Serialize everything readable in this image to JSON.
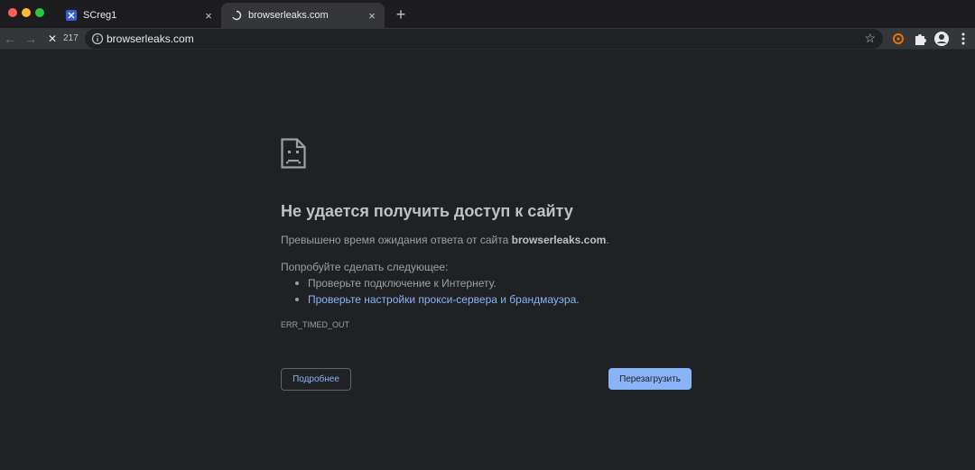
{
  "window": {
    "traffic_colors": [
      "#ff5f57",
      "#febc2e",
      "#28c840"
    ]
  },
  "tabs": [
    {
      "title": "SCreg1",
      "icon": "screg-favicon",
      "close": "×"
    },
    {
      "title": "browserleaks.com",
      "icon": "loading-spinner-icon",
      "close": "×"
    }
  ],
  "newtab": {
    "label": "+"
  },
  "toolbar": {
    "back": "←",
    "forward": "→",
    "stop": "✕",
    "load_counter": "217",
    "url": "browserleaks.com",
    "star": "☆"
  },
  "error": {
    "heading": "Не удается получить доступ к сайту",
    "desc_prefix": "Превышено время ожидания ответа от сайта ",
    "desc_host": "browserleaks.com",
    "desc_suffix": ".",
    "try_label": "Попробуйте сделать следующее:",
    "suggestions": [
      "Проверьте подключение к Интернету.",
      "Проверьте настройки прокси-сервера и брандмауэра."
    ],
    "code": "ERR_TIMED_OUT",
    "details_button": "Подробнее",
    "reload_button": "Перезагрузить"
  },
  "colors": {
    "background": "#202124",
    "link": "#8ab4f8",
    "accent": "#8ab4f8"
  }
}
